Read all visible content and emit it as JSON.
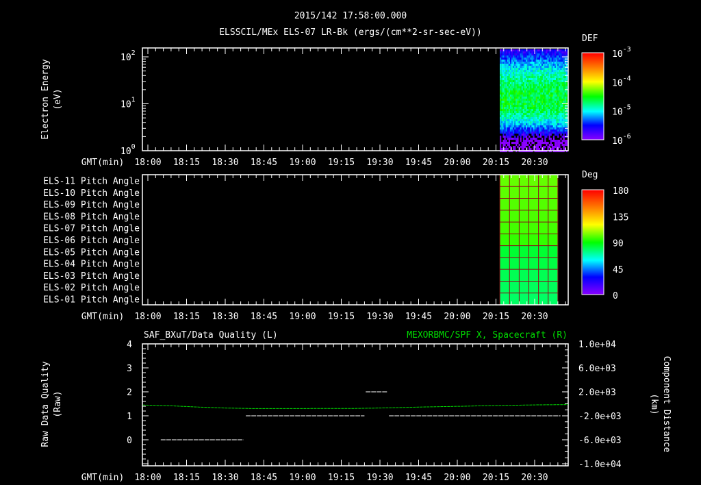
{
  "header": {
    "title": "2015/142 17:58:00.000",
    "subtitle": "ELSSCIL/MEx ELS-07 LR-Bk  (ergs/(cm**2-sr-sec-eV))"
  },
  "chart_data": [
    {
      "type": "heatmap",
      "name": "electron-energy-spectrogram",
      "ylabel": [
        "Electron Energy",
        "(eV)"
      ],
      "yscale": "log",
      "ylim": [
        1,
        155
      ],
      "yticks": [
        {
          "base": "10",
          "exp": "0",
          "value": 1
        },
        {
          "base": "10",
          "exp": "1",
          "value": 10
        },
        {
          "base": "10",
          "exp": "2",
          "value": 100
        }
      ],
      "xlabel": "GMT(min)",
      "xticks": [
        "18:00",
        "18:15",
        "18:30",
        "18:45",
        "19:00",
        "19:15",
        "19:30",
        "19:45",
        "20:00",
        "20:15",
        "20:30"
      ],
      "xlim_minutes_from_1800": [
        -2.5,
        163
      ],
      "data_start_minutes": 136.5,
      "data_end_minutes": 164,
      "peak_energy_eV": 12,
      "peak_log_def": -4.6,
      "colorbar": {
        "label": "DEF",
        "scale": "log",
        "range": [
          -6,
          -3
        ],
        "ticks": [
          {
            "base": "10",
            "exp": "-3"
          },
          {
            "base": "10",
            "exp": "-4"
          },
          {
            "base": "10",
            "exp": "-5"
          },
          {
            "base": "10",
            "exp": "-6"
          }
        ]
      }
    },
    {
      "type": "heatmap",
      "name": "pitch-angle",
      "rows": [
        "ELS-11 Pitch Angle",
        "ELS-10 Pitch Angle",
        "ELS-09 Pitch Angle",
        "ELS-08 Pitch Angle",
        "ELS-07 Pitch Angle",
        "ELS-06 Pitch Angle",
        "ELS-05 Pitch Angle",
        "ELS-04 Pitch Angle",
        "ELS-03 Pitch Angle",
        "ELS-02 Pitch Angle",
        "ELS-01 Pitch Angle"
      ],
      "row_values_deg": [
        102,
        101,
        100,
        99,
        98,
        96,
        84,
        82,
        80,
        79,
        78
      ],
      "xlabel": "GMT(min)",
      "xticks": [
        "18:00",
        "18:15",
        "18:30",
        "18:45",
        "19:00",
        "19:15",
        "19:30",
        "19:45",
        "20:00",
        "20:15",
        "20:30"
      ],
      "data_start_minutes": 136.5,
      "data_end_minutes": 159,
      "colorbar": {
        "label": "Deg",
        "range": [
          0,
          180
        ],
        "ticks": [
          "180",
          "135",
          "90",
          "45",
          "0"
        ]
      }
    },
    {
      "type": "line",
      "name": "data-quality-and-distance",
      "left_title": "SAF_BXuT/Data Quality (L)",
      "right_title": "MEXORBMC/SPF X, Spacecraft (R)",
      "ylabel_left": [
        "Raw Data Quality",
        "(Raw)"
      ],
      "ylabel_right": [
        "Component Distance",
        "(km)"
      ],
      "yticks_left": [
        "4",
        "3",
        "2",
        "1",
        "0"
      ],
      "ylim_left": [
        -1.1,
        4
      ],
      "yticks_right": [
        "1.0e+04",
        "6.0e+03",
        "2.0e+03",
        "-2.0e+03",
        "-6.0e+03",
        "-1.0e+04"
      ],
      "ylim_right": [
        -10000,
        10000
      ],
      "xlabel": "GMT(min)",
      "xticks": [
        "18:00",
        "18:15",
        "18:30",
        "18:45",
        "19:00",
        "19:15",
        "19:30",
        "19:45",
        "20:00",
        "20:15",
        "20:30"
      ],
      "series": [
        {
          "name": "Data Quality",
          "axis": "left",
          "color": "#ffffff",
          "segments": [
            {
              "x": [
                5,
                37
              ],
              "y": 0
            },
            {
              "x": [
                38,
                84
              ],
              "y": 1
            },
            {
              "x": [
                84.5,
                93
              ],
              "y": 2
            },
            {
              "x": [
                93.5,
                160
              ],
              "y": 1
            }
          ]
        },
        {
          "name": "SPF X, Spacecraft",
          "axis": "right",
          "color": "#00dd00",
          "x": [
            -2,
            10,
            20,
            30,
            40,
            60,
            80,
            90,
            100,
            110,
            120,
            130,
            140,
            150,
            163
          ],
          "y": [
            -200,
            -350,
            -550,
            -700,
            -780,
            -780,
            -770,
            -700,
            -600,
            -500,
            -420,
            -330,
            -250,
            -180,
            -130
          ]
        }
      ]
    }
  ],
  "colors": {
    "green": "#00dd00",
    "grid": "#8b0a1a"
  }
}
